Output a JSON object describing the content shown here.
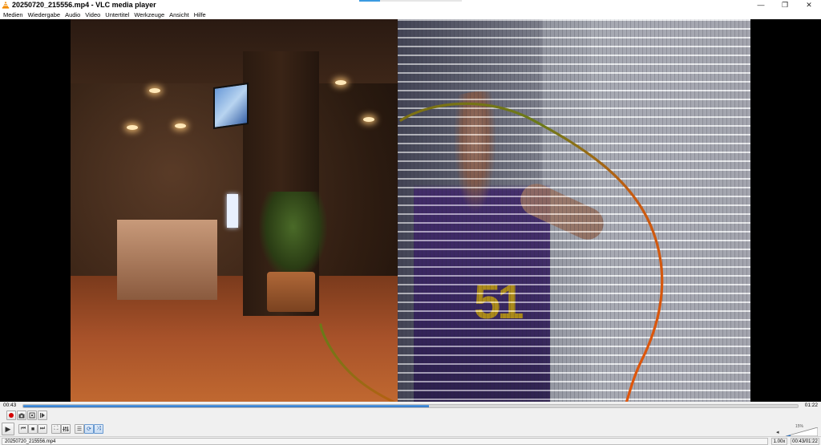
{
  "window": {
    "title": "20250720_215556.mp4 - VLC media player",
    "controls": {
      "minimize": "—",
      "restore": "❐",
      "close": "✕"
    }
  },
  "menu": {
    "items": [
      "Medien",
      "Wiedergabe",
      "Audio",
      "Video",
      "Untertitel",
      "Werkzeuge",
      "Ansicht",
      "Hilfe"
    ]
  },
  "video": {
    "jersey_number": "51",
    "annotation_color": "#e8540a"
  },
  "player": {
    "time_elapsed": "00:43",
    "time_total": "01:22",
    "progress_fraction": 0.524,
    "accent_color": "#2a74c8"
  },
  "buttons": {
    "record": "record-icon",
    "snapshot": "camera-icon",
    "loop_ab": "loop-ab-icon",
    "frame_step": "frame-step-icon",
    "play": "▶",
    "prev": "⏮",
    "stop": "■",
    "next": "⏭",
    "fullscreen": "⛶",
    "extended": "equalizer-icon",
    "playlist": "☰",
    "loop": "⟳",
    "shuffle": "⤨"
  },
  "volume": {
    "level_label": "15%",
    "level_fraction": 0.15
  },
  "status": {
    "filename": "20250720_215556.mp4",
    "speed": "1.00x",
    "time": "00:43/01:22"
  }
}
